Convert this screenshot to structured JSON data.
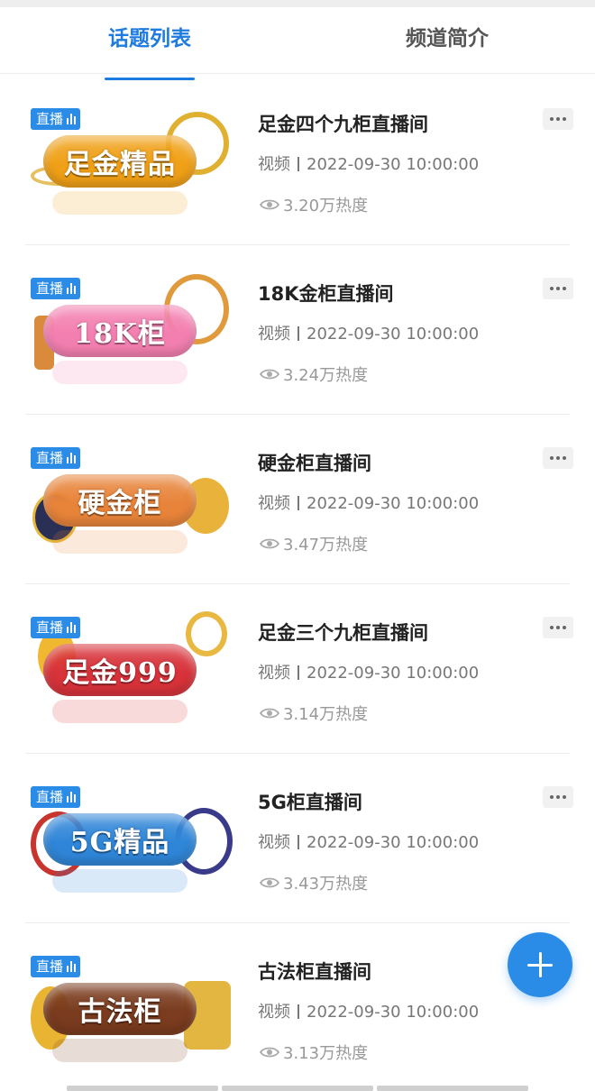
{
  "tabs": [
    {
      "label": "话题列表",
      "active": true
    },
    {
      "label": "频道简介",
      "active": false
    }
  ],
  "colors": {
    "accent": "#1e7be0",
    "live_tag": "#2b8ce8",
    "fab": "#2b8ce8"
  },
  "items": [
    {
      "badge": "直播",
      "thumb_text": "足金精品",
      "title": "足金四个九柜直播间",
      "type": "视频",
      "date": "2022-09-30 10:00:00",
      "heat": "3.20万热度",
      "pill_color": "#f0a016"
    },
    {
      "badge": "直播",
      "thumb_text": "18K柜",
      "title": "18K金柜直播间",
      "type": "视频",
      "date": "2022-09-30 10:00:00",
      "heat": "3.24万热度",
      "pill_color": "#f37fb0"
    },
    {
      "badge": "直播",
      "thumb_text": "硬金柜",
      "title": "硬金柜直播间",
      "type": "视频",
      "date": "2022-09-30 10:00:00",
      "heat": "3.47万热度",
      "pill_color": "#e8843a"
    },
    {
      "badge": "直播",
      "thumb_text": "足金999",
      "title": "足金三个九柜直播间",
      "type": "视频",
      "date": "2022-09-30 10:00:00",
      "heat": "3.14万热度",
      "pill_color": "#d8323a"
    },
    {
      "badge": "直播",
      "thumb_text": "5G精品",
      "title": "5G柜直播间",
      "type": "视频",
      "date": "2022-09-30 10:00:00",
      "heat": "3.43万热度",
      "pill_color": "#2f86d8"
    },
    {
      "badge": "直播",
      "thumb_text": "古法柜",
      "title": "古法柜直播间",
      "type": "视频",
      "date": "2022-09-30 10:00:00",
      "heat": "3.13万热度",
      "pill_color": "#7a3b1e"
    }
  ],
  "icons": {
    "more": "more-dots-icon",
    "heat": "eye-icon",
    "add": "plus-icon",
    "live": "live-bars-icon"
  }
}
